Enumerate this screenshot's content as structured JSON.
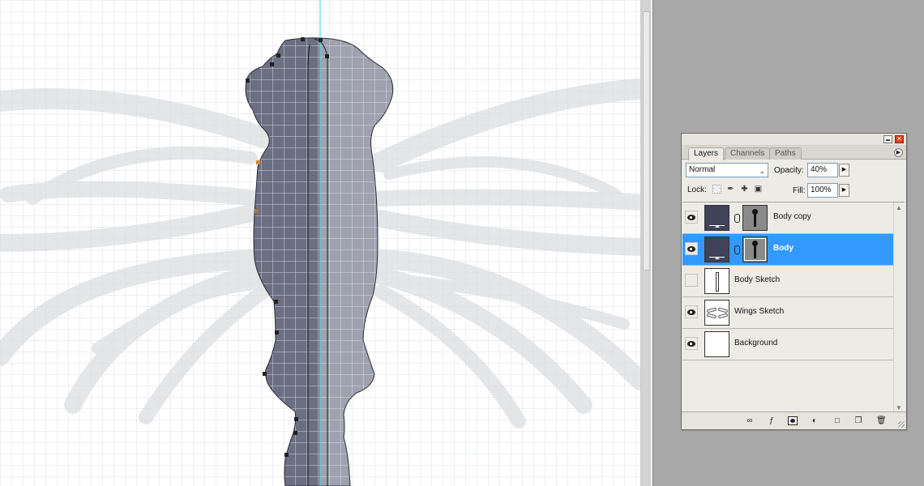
{
  "colors": {
    "canvas_bg": "#ffffff",
    "grid_line": "#dcdfe4",
    "wings_sketch": "#e5e6e8",
    "body_fill": "#6c6e82",
    "guide": "#33d6f0",
    "selected_row": "#3399ff",
    "panel_bg": "#ecebe6"
  },
  "panel": {
    "tabs": [
      {
        "label": "Layers",
        "active": true
      },
      {
        "label": "Channels",
        "active": false
      },
      {
        "label": "Paths",
        "active": false
      }
    ],
    "close_glyph": "✕",
    "menu_glyph": "▶"
  },
  "options": {
    "blend_mode": "Normal",
    "opacity_label": "Opacity:",
    "opacity_value": "40%",
    "fill_label": "Fill:",
    "fill_value": "100%",
    "lock_label": "Lock:",
    "stepper_glyph": "▶"
  },
  "layers": [
    {
      "name": "Body copy",
      "visible": true,
      "selected": false,
      "thumb": "dark",
      "has_mask": true
    },
    {
      "name": "Body",
      "visible": true,
      "selected": true,
      "thumb": "dark",
      "has_mask": true
    },
    {
      "name": "Body Sketch",
      "visible": false,
      "selected": false,
      "thumb": "body-sketch",
      "has_mask": false
    },
    {
      "name": "Wings Sketch",
      "visible": true,
      "selected": false,
      "thumb": "wings",
      "has_mask": false
    },
    {
      "name": "Background",
      "visible": true,
      "selected": false,
      "thumb": "white",
      "has_mask": false
    }
  ],
  "footer_icons": [
    "link-layers-icon",
    "layer-style-icon",
    "layer-mask-icon",
    "adjustment-layer-icon",
    "new-group-icon",
    "new-layer-icon",
    "delete-layer-icon"
  ]
}
